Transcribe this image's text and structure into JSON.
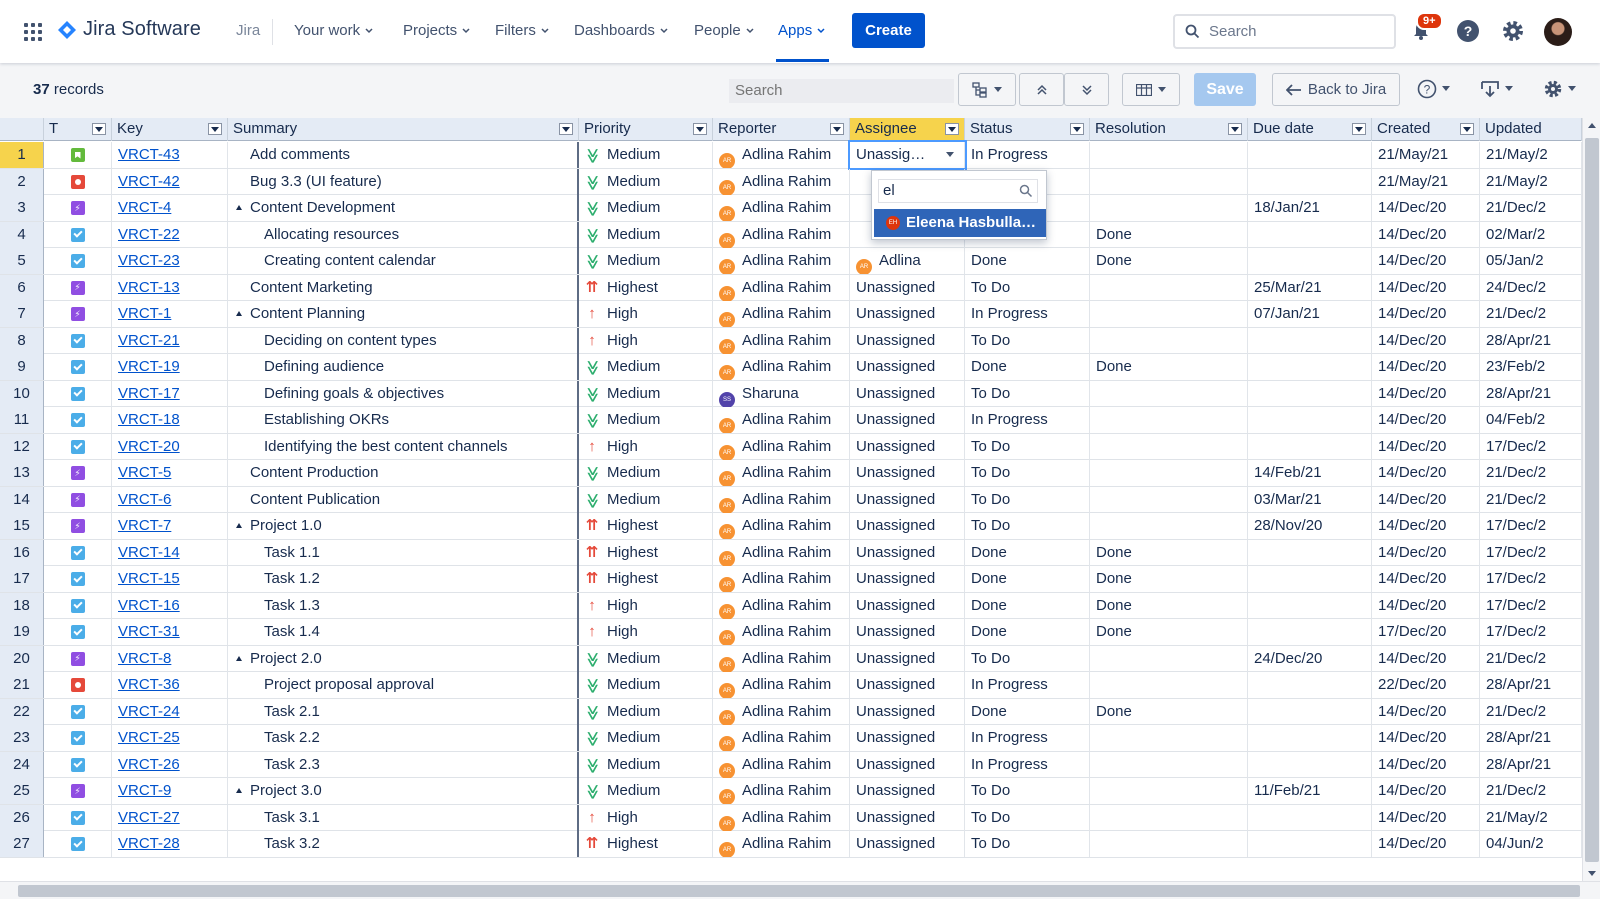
{
  "nav": {
    "product": "Jira Software",
    "jira_label": "Jira",
    "items": [
      {
        "label": "Your work"
      },
      {
        "label": "Projects"
      },
      {
        "label": "Filters"
      },
      {
        "label": "Dashboards"
      },
      {
        "label": "People"
      },
      {
        "label": "Apps"
      }
    ],
    "active_item": "Apps",
    "create_label": "Create",
    "search_placeholder": "Search",
    "notification_badge": "9+"
  },
  "toolbar": {
    "record_count": "37",
    "record_label": "records",
    "search_placeholder": "Search",
    "save_label": "Save",
    "back_label": "Back to Jira"
  },
  "columns": [
    {
      "label": "T"
    },
    {
      "label": "Key"
    },
    {
      "label": "Summary"
    },
    {
      "label": "Priority"
    },
    {
      "label": "Reporter"
    },
    {
      "label": "Assignee"
    },
    {
      "label": "Status"
    },
    {
      "label": "Resolution"
    },
    {
      "label": "Due date"
    },
    {
      "label": "Created"
    },
    {
      "label": "Updated"
    }
  ],
  "selected_column": "Assignee",
  "rows": [
    {
      "n": "1",
      "type": "story",
      "key": "VRCT-43",
      "summary": "Add comments",
      "indent": 1,
      "parent": false,
      "priority": "Medium",
      "reporter": "Adlina Rahim",
      "reporter_initials": "AR",
      "assignee": "Unassig…",
      "status": "In Progress",
      "resolution": "",
      "due": "",
      "created": "21/May/21",
      "updated": "21/May/2"
    },
    {
      "n": "2",
      "type": "bug",
      "key": "VRCT-42",
      "summary": "Bug 3.3 (UI feature)",
      "indent": 1,
      "parent": false,
      "priority": "Medium",
      "reporter": "Adlina Rahim",
      "reporter_initials": "AR",
      "assignee": "",
      "status": "",
      "resolution": "",
      "due": "",
      "created": "21/May/21",
      "updated": "21/May/2"
    },
    {
      "n": "3",
      "type": "epic",
      "key": "VRCT-4",
      "summary": "Content Development",
      "indent": 0,
      "parent": true,
      "priority": "Medium",
      "reporter": "Adlina Rahim",
      "reporter_initials": "AR",
      "assignee": "",
      "status": "",
      "resolution": "",
      "due": "18/Jan/21",
      "created": "14/Dec/20",
      "updated": "21/Dec/2"
    },
    {
      "n": "4",
      "type": "task",
      "key": "VRCT-22",
      "summary": "Allocating resources",
      "indent": 2,
      "parent": false,
      "priority": "Medium",
      "reporter": "Adlina Rahim",
      "reporter_initials": "AR",
      "assignee": "",
      "status": "",
      "resolution": "Done",
      "due": "",
      "created": "14/Dec/20",
      "updated": "02/Mar/2"
    },
    {
      "n": "5",
      "type": "task",
      "key": "VRCT-23",
      "summary": "Creating content calendar",
      "indent": 2,
      "parent": false,
      "priority": "Medium",
      "reporter": "Adlina Rahim",
      "reporter_initials": "AR",
      "assignee": "Adlina",
      "assignee_initials": "AR",
      "status": "Done",
      "resolution": "Done",
      "due": "",
      "created": "14/Dec/20",
      "updated": "05/Jan/2"
    },
    {
      "n": "6",
      "type": "epic",
      "key": "VRCT-13",
      "summary": "Content Marketing",
      "indent": 1,
      "parent": false,
      "priority": "Highest",
      "reporter": "Adlina Rahim",
      "reporter_initials": "AR",
      "assignee": "Unassigned",
      "status": "To Do",
      "resolution": "",
      "due": "25/Mar/21",
      "created": "14/Dec/20",
      "updated": "24/Dec/2"
    },
    {
      "n": "7",
      "type": "epic",
      "key": "VRCT-1",
      "summary": "Content Planning",
      "indent": 0,
      "parent": true,
      "priority": "High",
      "reporter": "Adlina Rahim",
      "reporter_initials": "AR",
      "assignee": "Unassigned",
      "status": "In Progress",
      "resolution": "",
      "due": "07/Jan/21",
      "created": "14/Dec/20",
      "updated": "21/Dec/2"
    },
    {
      "n": "8",
      "type": "task",
      "key": "VRCT-21",
      "summary": "Deciding on content types",
      "indent": 2,
      "parent": false,
      "priority": "High",
      "reporter": "Adlina Rahim",
      "reporter_initials": "AR",
      "assignee": "Unassigned",
      "status": "To Do",
      "resolution": "",
      "due": "",
      "created": "14/Dec/20",
      "updated": "28/Apr/21"
    },
    {
      "n": "9",
      "type": "task",
      "key": "VRCT-19",
      "summary": "Defining audience",
      "indent": 2,
      "parent": false,
      "priority": "Medium",
      "reporter": "Adlina Rahim",
      "reporter_initials": "AR",
      "assignee": "Unassigned",
      "status": "Done",
      "resolution": "Done",
      "due": "",
      "created": "14/Dec/20",
      "updated": "23/Feb/2"
    },
    {
      "n": "10",
      "type": "task",
      "key": "VRCT-17",
      "summary": "Defining goals & objectives",
      "indent": 2,
      "parent": false,
      "priority": "Medium",
      "reporter": "Sharuna",
      "reporter_initials": "SS",
      "assignee": "Unassigned",
      "status": "To Do",
      "resolution": "",
      "due": "",
      "created": "14/Dec/20",
      "updated": "28/Apr/21"
    },
    {
      "n": "11",
      "type": "task",
      "key": "VRCT-18",
      "summary": "Establishing OKRs",
      "indent": 2,
      "parent": false,
      "priority": "Medium",
      "reporter": "Adlina Rahim",
      "reporter_initials": "AR",
      "assignee": "Unassigned",
      "status": "In Progress",
      "resolution": "",
      "due": "",
      "created": "14/Dec/20",
      "updated": "04/Feb/2"
    },
    {
      "n": "12",
      "type": "task",
      "key": "VRCT-20",
      "summary": "Identifying the best content channels",
      "indent": 2,
      "parent": false,
      "priority": "High",
      "reporter": "Adlina Rahim",
      "reporter_initials": "AR",
      "assignee": "Unassigned",
      "status": "To Do",
      "resolution": "",
      "due": "",
      "created": "14/Dec/20",
      "updated": "17/Dec/2"
    },
    {
      "n": "13",
      "type": "epic",
      "key": "VRCT-5",
      "summary": "Content Production",
      "indent": 1,
      "parent": false,
      "priority": "Medium",
      "reporter": "Adlina Rahim",
      "reporter_initials": "AR",
      "assignee": "Unassigned",
      "status": "To Do",
      "resolution": "",
      "due": "14/Feb/21",
      "created": "14/Dec/20",
      "updated": "21/Dec/2"
    },
    {
      "n": "14",
      "type": "epic",
      "key": "VRCT-6",
      "summary": "Content Publication",
      "indent": 1,
      "parent": false,
      "priority": "Medium",
      "reporter": "Adlina Rahim",
      "reporter_initials": "AR",
      "assignee": "Unassigned",
      "status": "To Do",
      "resolution": "",
      "due": "03/Mar/21",
      "created": "14/Dec/20",
      "updated": "21/Dec/2"
    },
    {
      "n": "15",
      "type": "epic",
      "key": "VRCT-7",
      "summary": "Project 1.0",
      "indent": 0,
      "parent": true,
      "priority": "Highest",
      "reporter": "Adlina Rahim",
      "reporter_initials": "AR",
      "assignee": "Unassigned",
      "status": "To Do",
      "resolution": "",
      "due": "28/Nov/20",
      "created": "14/Dec/20",
      "updated": "17/Dec/2"
    },
    {
      "n": "16",
      "type": "task",
      "key": "VRCT-14",
      "summary": "Task 1.1",
      "indent": 2,
      "parent": false,
      "priority": "Highest",
      "reporter": "Adlina Rahim",
      "reporter_initials": "AR",
      "assignee": "Unassigned",
      "status": "Done",
      "resolution": "Done",
      "due": "",
      "created": "14/Dec/20",
      "updated": "17/Dec/2"
    },
    {
      "n": "17",
      "type": "task",
      "key": "VRCT-15",
      "summary": "Task 1.2",
      "indent": 2,
      "parent": false,
      "priority": "Highest",
      "reporter": "Adlina Rahim",
      "reporter_initials": "AR",
      "assignee": "Unassigned",
      "status": "Done",
      "resolution": "Done",
      "due": "",
      "created": "14/Dec/20",
      "updated": "17/Dec/2"
    },
    {
      "n": "18",
      "type": "task",
      "key": "VRCT-16",
      "summary": "Task 1.3",
      "indent": 2,
      "parent": false,
      "priority": "High",
      "reporter": "Adlina Rahim",
      "reporter_initials": "AR",
      "assignee": "Unassigned",
      "status": "Done",
      "resolution": "Done",
      "due": "",
      "created": "14/Dec/20",
      "updated": "17/Dec/2"
    },
    {
      "n": "19",
      "type": "task",
      "key": "VRCT-31",
      "summary": "Task 1.4",
      "indent": 2,
      "parent": false,
      "priority": "High",
      "reporter": "Adlina Rahim",
      "reporter_initials": "AR",
      "assignee": "Unassigned",
      "status": "Done",
      "resolution": "Done",
      "due": "",
      "created": "17/Dec/20",
      "updated": "17/Dec/2"
    },
    {
      "n": "20",
      "type": "epic",
      "key": "VRCT-8",
      "summary": "Project 2.0",
      "indent": 0,
      "parent": true,
      "priority": "Medium",
      "reporter": "Adlina Rahim",
      "reporter_initials": "AR",
      "assignee": "Unassigned",
      "status": "To Do",
      "resolution": "",
      "due": "24/Dec/20",
      "created": "14/Dec/20",
      "updated": "21/Dec/2"
    },
    {
      "n": "21",
      "type": "bug",
      "key": "VRCT-36",
      "summary": "Project proposal approval",
      "indent": 2,
      "parent": false,
      "priority": "Medium",
      "reporter": "Adlina Rahim",
      "reporter_initials": "AR",
      "assignee": "Unassigned",
      "status": "In Progress",
      "resolution": "",
      "due": "",
      "created": "22/Dec/20",
      "updated": "28/Apr/21"
    },
    {
      "n": "22",
      "type": "task",
      "key": "VRCT-24",
      "summary": "Task 2.1",
      "indent": 2,
      "parent": false,
      "priority": "Medium",
      "reporter": "Adlina Rahim",
      "reporter_initials": "AR",
      "assignee": "Unassigned",
      "status": "Done",
      "resolution": "Done",
      "due": "",
      "created": "14/Dec/20",
      "updated": "21/Dec/2"
    },
    {
      "n": "23",
      "type": "task",
      "key": "VRCT-25",
      "summary": "Task 2.2",
      "indent": 2,
      "parent": false,
      "priority": "Medium",
      "reporter": "Adlina Rahim",
      "reporter_initials": "AR",
      "assignee": "Unassigned",
      "status": "In Progress",
      "resolution": "",
      "due": "",
      "created": "14/Dec/20",
      "updated": "28/Apr/21"
    },
    {
      "n": "24",
      "type": "task",
      "key": "VRCT-26",
      "summary": "Task 2.3",
      "indent": 2,
      "parent": false,
      "priority": "Medium",
      "reporter": "Adlina Rahim",
      "reporter_initials": "AR",
      "assignee": "Unassigned",
      "status": "In Progress",
      "resolution": "",
      "due": "",
      "created": "14/Dec/20",
      "updated": "28/Apr/21"
    },
    {
      "n": "25",
      "type": "epic",
      "key": "VRCT-9",
      "summary": "Project 3.0",
      "indent": 0,
      "parent": true,
      "priority": "Medium",
      "reporter": "Adlina Rahim",
      "reporter_initials": "AR",
      "assignee": "Unassigned",
      "status": "To Do",
      "resolution": "",
      "due": "11/Feb/21",
      "created": "14/Dec/20",
      "updated": "21/Dec/2"
    },
    {
      "n": "26",
      "type": "task",
      "key": "VRCT-27",
      "summary": "Task 3.1",
      "indent": 2,
      "parent": false,
      "priority": "High",
      "reporter": "Adlina Rahim",
      "reporter_initials": "AR",
      "assignee": "Unassigned",
      "status": "To Do",
      "resolution": "",
      "due": "",
      "created": "14/Dec/20",
      "updated": "21/May/2"
    },
    {
      "n": "27",
      "type": "task",
      "key": "VRCT-28",
      "summary": "Task 3.2",
      "indent": 2,
      "parent": false,
      "priority": "Highest",
      "reporter": "Adlina Rahim",
      "reporter_initials": "AR",
      "assignee": "Unassigned",
      "status": "To Do",
      "resolution": "",
      "due": "",
      "created": "14/Dec/20",
      "updated": "04/Jun/2"
    }
  ],
  "assignee_popup": {
    "query": "el",
    "option": "Eleena Hasbulla…",
    "option_initials": "EH"
  },
  "colors": {
    "brand": "#0052cc",
    "header_bg": "#e4ebf5",
    "selected": "#f6d34c",
    "medium_priority": "#2dae6e",
    "high_priority": "#e5493a"
  }
}
